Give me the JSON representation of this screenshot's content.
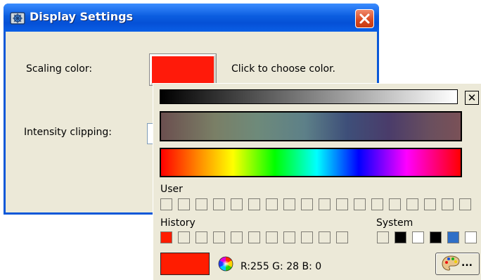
{
  "window": {
    "title": "Display Settings",
    "close_glyph": "✕"
  },
  "form": {
    "scaling_label": "Scaling color:",
    "scaling_value": "#ff1a0a",
    "click_hint": "Click to choose color.",
    "intensity_label": "Intensity clipping:",
    "intensity_value": ""
  },
  "picker": {
    "close_glyph": "✕",
    "user_label": "User",
    "history_label": "History",
    "system_label": "System",
    "user_colors": [
      "",
      "",
      "",
      "",
      "",
      "",
      "",
      "",
      "",
      "",
      "",
      "",
      "",
      "",
      "",
      "",
      "",
      ""
    ],
    "history_colors": [
      "#ff1c00",
      "",
      "",
      "",
      "",
      "",
      "",
      "",
      "",
      "",
      ""
    ],
    "system_colors": [
      "#ece9d8",
      "#000000",
      "#ffffff",
      "#000000",
      "#2f6fc7",
      "#ffffff"
    ],
    "current_color": "#ff1c00",
    "rgb_text": "R:255 G: 28 B:  0",
    "palette_button_text": "..."
  },
  "icons": {
    "app": "display-settings-app-icon",
    "wheel": "color-wheel-icon",
    "palette": "palette-icon"
  },
  "colors": {
    "titlebar": "#0b5de0",
    "dialog_bg": "#ece9d8",
    "close_red": "#d9481f"
  }
}
